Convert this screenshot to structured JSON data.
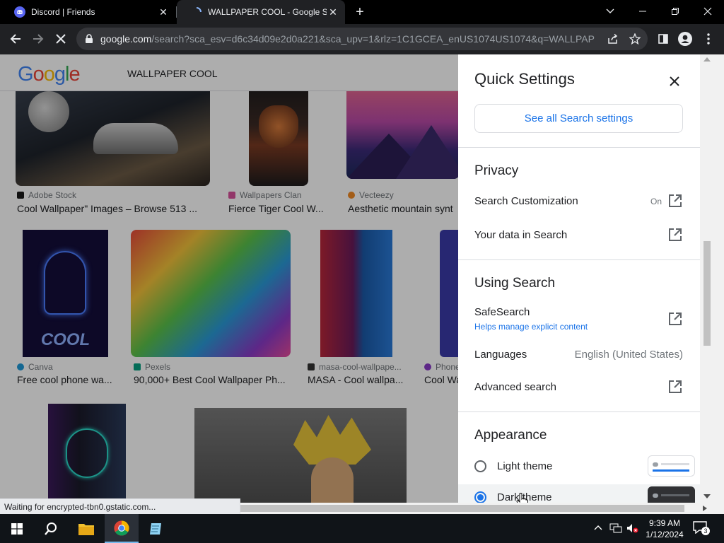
{
  "browser": {
    "tabs": [
      {
        "title": "Discord | Friends",
        "close": "✕"
      },
      {
        "title": "WALLPAPER COOL - Google Search",
        "close": "✕"
      }
    ],
    "new_tab": "+",
    "url_host": "google.com",
    "url_rest": "/search?sca_esv=d6c34d09e2d0a221&sca_upv=1&rlz=1C1GCEA_enUS1074US1074&q=WALLPAPER..."
  },
  "google": {
    "logo": "Google",
    "query": "WALLPAPER COOL"
  },
  "results": {
    "row1": [
      {
        "source": "Adobe Stock",
        "caption": "Cool Wallpaper\" Images – Browse 513 ..."
      },
      {
        "source": "Wallpapers Clan",
        "caption": "Fierce Tiger Cool W..."
      },
      {
        "source": "Vecteezy",
        "caption": "Aesthetic mountain synt"
      }
    ],
    "row2": [
      {
        "source": "Canva",
        "caption": "Free cool phone wa..."
      },
      {
        "source": "Pexels",
        "caption": "90,000+ Best Cool Wallpaper Ph..."
      },
      {
        "source": "masa-cool-wallpape...",
        "caption": "MASA - Cool wallpa..."
      },
      {
        "source": "Phone",
        "caption": "Cool Wa"
      }
    ],
    "cool_text": "COOL"
  },
  "quick_settings": {
    "title": "Quick Settings",
    "see_all": "See all Search settings",
    "privacy": {
      "heading": "Privacy",
      "search_customization": "Search Customization",
      "search_customization_state": "On",
      "your_data": "Your data in Search"
    },
    "using_search": {
      "heading": "Using Search",
      "safesearch": "SafeSearch",
      "safesearch_sub": "Helps manage explicit content",
      "languages": "Languages",
      "languages_value": "English (United States)",
      "advanced": "Advanced search"
    },
    "appearance": {
      "heading": "Appearance",
      "light": "Light theme",
      "dark": "Dark theme",
      "selected": "Dark theme"
    }
  },
  "status_text": "Waiting for encrypted-tbn0.gstatic.com...",
  "taskbar": {
    "time": "9:39 AM",
    "date": "1/12/2024",
    "notification_count": "3"
  },
  "colors": {
    "accent": "#1a73e8",
    "taskbar": "#101418",
    "chrome_dark": "#202124"
  }
}
